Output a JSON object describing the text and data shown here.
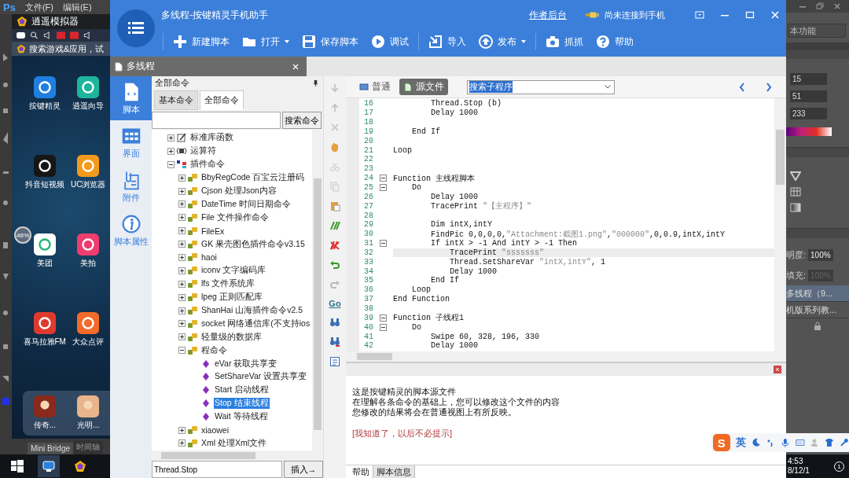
{
  "photoshop": {
    "logo": "Ps",
    "menus": [
      "文件(F)",
      "编辑(E)"
    ],
    "bottom_tabs": [
      {
        "label": "Mini Bridge",
        "selected": true
      },
      {
        "label": "时间轴",
        "selected": false
      }
    ],
    "workspace": "本功能",
    "color_values": [
      "15",
      "51",
      "233"
    ],
    "opacity_label": "明度:",
    "opacity": "100%",
    "fill_label": "填充:",
    "fill": "100%",
    "layers": [
      {
        "name": "多线程（9...",
        "selected": true
      },
      {
        "name": "机版系列教...",
        "selected": false
      }
    ]
  },
  "emulator": {
    "title": "逍遥模拟器",
    "search": "搜索游戏&应用，试",
    "battery": "46%",
    "apps": [
      {
        "label": "按键精灵",
        "color": "#1f7fe0"
      },
      {
        "label": "逍遥向导",
        "color": "#1db59c"
      },
      {
        "label": "抖音短视频",
        "color": "#161616"
      },
      {
        "label": "UC浏览器",
        "color": "#f39a1e"
      },
      {
        "label": "美团",
        "color": "#ffffff"
      },
      {
        "label": "美拍",
        "color": "#ee3d6e"
      },
      {
        "label": "喜马拉雅FM",
        "color": "#e03a2e"
      },
      {
        "label": "大众点评",
        "color": "#f26b2a"
      }
    ],
    "dock": [
      {
        "label": "传奇...",
        "color": "#8a2a1a"
      },
      {
        "label": "光明...",
        "color": "#e8b58a"
      }
    ]
  },
  "app": {
    "title": "多线程-按键精灵手机助手",
    "author_link": "作者后台",
    "connection": "尚未连接到手机",
    "toolbar": [
      {
        "label": "新建脚本",
        "menu": false
      },
      {
        "label": "打开",
        "menu": true
      },
      {
        "label": "保存脚本",
        "menu": false
      },
      {
        "label": "调试",
        "menu": false
      },
      {
        "label": "导入",
        "menu": false
      },
      {
        "label": "发布",
        "menu": true
      },
      {
        "label": "抓抓",
        "menu": false
      },
      {
        "label": "帮助",
        "menu": false
      }
    ],
    "document_tab": "多线程"
  },
  "nav": [
    {
      "label": "脚本",
      "selected": true
    },
    {
      "label": "界面",
      "selected": false
    },
    {
      "label": "附件",
      "selected": false
    },
    {
      "label": "脚本属性",
      "selected": false
    }
  ],
  "commands": {
    "title": "全部命令",
    "tabs": [
      {
        "label": "基本命令",
        "selected": false
      },
      {
        "label": "全部命令",
        "selected": true
      }
    ],
    "search_button": "搜索命令",
    "tree": [
      {
        "label": "标准库函数",
        "expanded": false,
        "selected": false
      },
      {
        "label": "运算符",
        "expanded": false,
        "selected": false
      },
      {
        "label": "插件命令",
        "expanded": true,
        "selected": false,
        "children": [
          {
            "label": "BbyRegCode 百宝云注册码",
            "expanded": false,
            "selected": false
          },
          {
            "label": "Cjson 处理Json内容",
            "expanded": false,
            "selected": false
          },
          {
            "label": "DateTime 时间日期命令",
            "expanded": false,
            "selected": false
          },
          {
            "label": "File 文件操作命令",
            "expanded": false,
            "selected": false
          },
          {
            "label": "FileEx",
            "expanded": false,
            "selected": false
          },
          {
            "label": "GK 果壳图色插件命令v3.15",
            "expanded": false,
            "selected": false
          },
          {
            "label": "haoi",
            "expanded": false,
            "selected": false
          },
          {
            "label": "iconv 文字编码库",
            "expanded": false,
            "selected": false
          },
          {
            "label": "lfs 文件系统库",
            "expanded": false,
            "selected": false
          },
          {
            "label": "lpeg 正则匹配库",
            "expanded": false,
            "selected": false
          },
          {
            "label": "ShanHai 山海插件命令v2.5",
            "expanded": false,
            "selected": false
          },
          {
            "label": "socket 网络通信库(不支持ios",
            "expanded": false,
            "selected": false
          },
          {
            "label": "轻量级的数据库",
            "expanded": false,
            "selected": false
          },
          {
            "label": "程命令",
            "expanded": true,
            "selected": false,
            "children": [
              {
                "label": "eVar 获取共享变",
                "selected": false
              },
              {
                "label": "SetShareVar 设置共享变",
                "selected": false
              },
              {
                "label": "Start 启动线程",
                "selected": false
              },
              {
                "label": "Stop 结束线程",
                "selected": true
              },
              {
                "label": "Wait 等待线程",
                "selected": false
              }
            ]
          },
          {
            "label": "xiaowei",
            "expanded": false,
            "selected": false
          },
          {
            "label": "Xml 处理Xml文件",
            "expanded": false,
            "selected": false
          }
        ]
      }
    ],
    "insert_value": "Thread.Stop",
    "insert_button": "插入→"
  },
  "tools": {
    "go": "Go"
  },
  "editor": {
    "views": [
      {
        "label": "普通",
        "selected": false
      },
      {
        "label": "源文件",
        "selected": true
      }
    ],
    "search": "搜索子程序",
    "lines": [
      {
        "num": "16",
        "fold": false,
        "current": false,
        "parts": [
          "        Thread.Stop (b)"
        ]
      },
      {
        "num": "17",
        "fold": false,
        "current": false,
        "parts": [
          "        Delay 1000"
        ]
      },
      {
        "num": "18",
        "fold": false,
        "current": false
      },
      {
        "num": "19",
        "fold": false,
        "current": false,
        "parts": [
          "    End If"
        ]
      },
      {
        "num": "20",
        "fold": false,
        "current": false
      },
      {
        "num": "21",
        "fold": false,
        "current": false,
        "parts": [
          "Loop"
        ]
      },
      {
        "num": "22",
        "fold": false,
        "current": false
      },
      {
        "num": "23",
        "fold": false,
        "current": false
      },
      {
        "num": "24",
        "fold": true,
        "current": false,
        "parts": [
          "Function 主线程脚本"
        ]
      },
      {
        "num": "25",
        "fold": true,
        "current": false,
        "parts": [
          "    Do"
        ]
      },
      {
        "num": "26",
        "fold": false,
        "current": false,
        "parts": [
          "        Delay 1000"
        ]
      },
      {
        "num": "27",
        "fold": false,
        "current": false,
        "parts": [
          "        TracePrint ",
          "\"【主程序】\""
        ]
      },
      {
        "num": "28",
        "fold": false,
        "current": false
      },
      {
        "num": "29",
        "fold": false,
        "current": false,
        "parts": [
          "        Dim intX,intY"
        ]
      },
      {
        "num": "30",
        "fold": false,
        "current": false,
        "parts": [
          "        FindPic 0,0,0,0,",
          "\"Attachment:截图1.png\"",
          ",",
          "\"000000\"",
          ",0,0.9,intX,intY"
        ]
      },
      {
        "num": "31",
        "fold": true,
        "current": false,
        "parts": [
          "        If intX > -1 And intY > -1 Then"
        ]
      },
      {
        "num": "32",
        "fold": false,
        "current": true,
        "parts": [
          "            TracePrint ",
          "\"sssssss\""
        ]
      },
      {
        "num": "33",
        "fold": false,
        "current": false,
        "parts": [
          "            Thread.SetShareVar ",
          "\"intX,intY\"",
          ", 1"
        ]
      },
      {
        "num": "34",
        "fold": false,
        "current": false,
        "parts": [
          "            Delay 1000"
        ]
      },
      {
        "num": "35",
        "fold": false,
        "current": false,
        "parts": [
          "        End If"
        ]
      },
      {
        "num": "36",
        "fold": false,
        "current": false,
        "parts": [
          "    Loop"
        ]
      },
      {
        "num": "37",
        "fold": false,
        "current": false,
        "parts": [
          "End Function"
        ]
      },
      {
        "num": "38",
        "fold": false,
        "current": false
      },
      {
        "num": "39",
        "fold": true,
        "current": false,
        "parts": [
          "Function 子线程1"
        ]
      },
      {
        "num": "40",
        "fold": true,
        "current": false,
        "parts": [
          "    Do"
        ]
      },
      {
        "num": "41",
        "fold": false,
        "current": false,
        "parts": [
          "        Swipe 60, 328, 196, 330"
        ]
      },
      {
        "num": "42",
        "fold": false,
        "current": false,
        "parts": [
          "        Delay 1000"
        ]
      }
    ]
  },
  "help": {
    "lines": [
      "这是按键精灵的脚本源文件",
      "在理解各条命令的基础上，您可以修改这个文件的内容",
      "您修改的结果将会在普通视图上有所反映。"
    ],
    "link": "[我知道了，以后不必提示]",
    "tabs": [
      {
        "label": "帮助",
        "selected": true
      },
      {
        "label": "脚本信息",
        "selected": false
      }
    ]
  },
  "ime": {
    "logo": "S",
    "mode": "英"
  },
  "taskbar": {
    "time": "4:53",
    "date": "8/12/1",
    "notifications": "1"
  }
}
